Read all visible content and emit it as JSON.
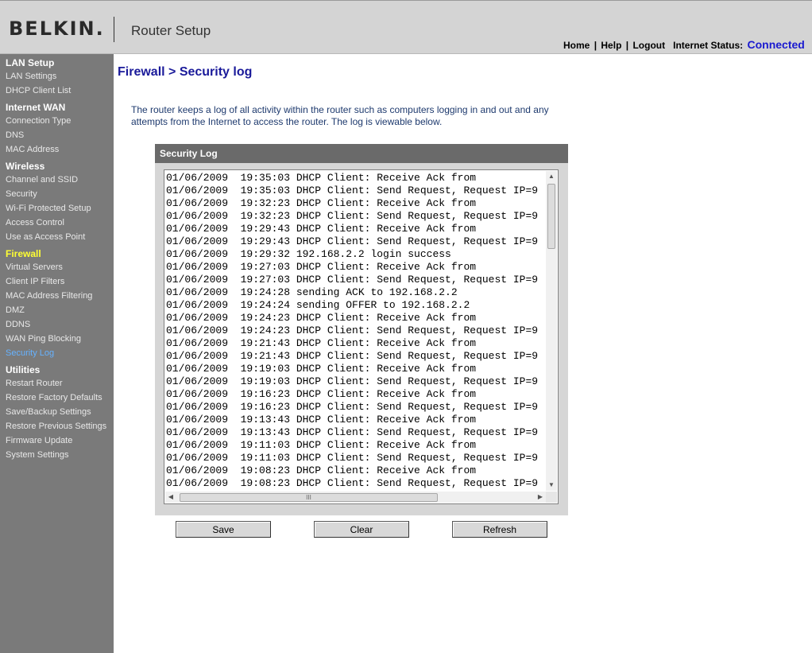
{
  "header": {
    "logo": "BELKIN.",
    "product": "Router Setup",
    "nav": {
      "home": "Home",
      "help": "Help",
      "logout": "Logout",
      "separator": "|",
      "status_label": "Internet Status:",
      "status_value": "Connected"
    },
    "status_color": "#1a1ad0"
  },
  "sidebar": {
    "sections": [
      {
        "title": "LAN Setup",
        "items": [
          "LAN Settings",
          "DHCP Client List"
        ]
      },
      {
        "title": "Internet WAN",
        "items": [
          "Connection Type",
          "DNS",
          "MAC Address"
        ]
      },
      {
        "title": "Wireless",
        "items": [
          "Channel and SSID",
          "Security",
          "Wi-Fi Protected Setup",
          "Access Control",
          "Use as Access Point"
        ]
      },
      {
        "title": "Firewall",
        "items": [
          "Virtual Servers",
          "Client IP Filters",
          "MAC Address Filtering",
          "DMZ",
          "DDNS",
          "WAN Ping Blocking",
          "Security Log"
        ]
      },
      {
        "title": "Utilities",
        "items": [
          "Restart Router",
          "Restore Factory Defaults",
          "Save/Backup Settings",
          "Restore Previous Settings",
          "Firmware Update",
          "System Settings"
        ]
      }
    ],
    "active_section": "Firewall",
    "active_item": "Security Log",
    "active_section_color": "#ffff33",
    "active_item_color": "#66b2ff"
  },
  "main": {
    "title": "Firewall > Security log",
    "intro": "The router keeps a log of all activity within the router such as computers logging in and out and any attempts from the Internet to access the router. The log is viewable below.",
    "panel_title": "Security Log",
    "log_lines": [
      "01/06/2009  19:35:03 DHCP Client: Receive Ack from",
      "01/06/2009  19:35:03 DHCP Client: Send Request, Request IP=9",
      "01/06/2009  19:32:23 DHCP Client: Receive Ack from",
      "01/06/2009  19:32:23 DHCP Client: Send Request, Request IP=9",
      "01/06/2009  19:29:43 DHCP Client: Receive Ack from",
      "01/06/2009  19:29:43 DHCP Client: Send Request, Request IP=9",
      "01/06/2009  19:29:32 192.168.2.2 login success",
      "01/06/2009  19:27:03 DHCP Client: Receive Ack from",
      "01/06/2009  19:27:03 DHCP Client: Send Request, Request IP=9",
      "01/06/2009  19:24:28 sending ACK to 192.168.2.2",
      "01/06/2009  19:24:24 sending OFFER to 192.168.2.2",
      "01/06/2009  19:24:23 DHCP Client: Receive Ack from",
      "01/06/2009  19:24:23 DHCP Client: Send Request, Request IP=9",
      "01/06/2009  19:21:43 DHCP Client: Receive Ack from",
      "01/06/2009  19:21:43 DHCP Client: Send Request, Request IP=9",
      "01/06/2009  19:19:03 DHCP Client: Receive Ack from",
      "01/06/2009  19:19:03 DHCP Client: Send Request, Request IP=9",
      "01/06/2009  19:16:23 DHCP Client: Receive Ack from",
      "01/06/2009  19:16:23 DHCP Client: Send Request, Request IP=9",
      "01/06/2009  19:13:43 DHCP Client: Receive Ack from",
      "01/06/2009  19:13:43 DHCP Client: Send Request, Request IP=9",
      "01/06/2009  19:11:03 DHCP Client: Receive Ack from",
      "01/06/2009  19:11:03 DHCP Client: Send Request, Request IP=9",
      "01/06/2009  19:08:23 DHCP Client: Receive Ack from",
      "01/06/2009  19:08:23 DHCP Client: Send Request, Request IP=9"
    ],
    "buttons": {
      "save": "Save",
      "clear": "Clear",
      "refresh": "Refresh"
    },
    "scroll_thumb_grip": "III"
  }
}
